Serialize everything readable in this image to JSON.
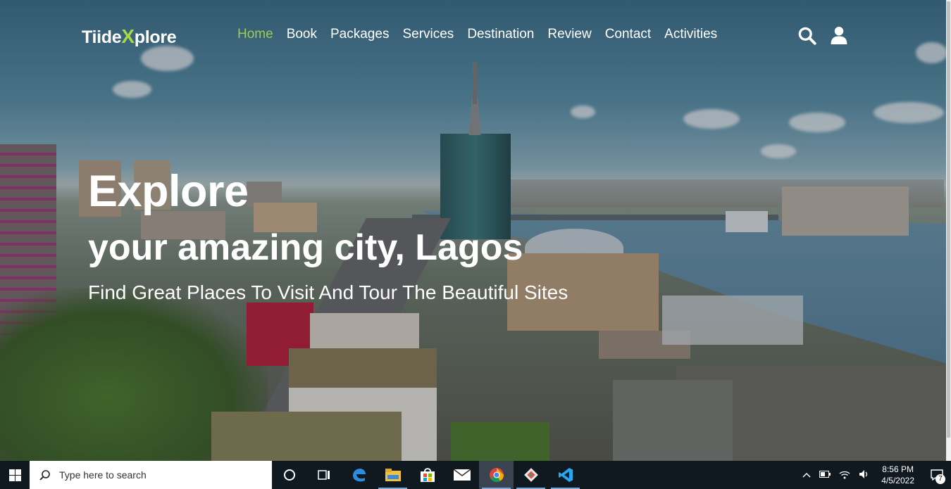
{
  "brand": {
    "prefix": "Tiide",
    "x": "X",
    "suffix": "plore",
    "accent": "#a6d84a"
  },
  "nav": {
    "items": [
      {
        "label": "Home",
        "active": true
      },
      {
        "label": "Book"
      },
      {
        "label": "Packages"
      },
      {
        "label": "Services"
      },
      {
        "label": "Destination"
      },
      {
        "label": "Review"
      },
      {
        "label": "Contact"
      },
      {
        "label": "Activities"
      }
    ],
    "active_color": "#9ccc55",
    "icons": [
      "search-icon",
      "user-icon"
    ]
  },
  "hero": {
    "heading": "Explore",
    "subheading": "your amazing city, Lagos",
    "tagline": "Find Great Places To Visit And Tour The Beautiful Sites"
  },
  "taskbar": {
    "search_placeholder": "Type here to search",
    "apps": [
      "cortana-icon",
      "task-view-icon",
      "edge-icon",
      "file-explorer-icon",
      "store-icon",
      "mail-icon",
      "chrome-icon",
      "git-icon",
      "vscode-icon"
    ],
    "time": "8:56 PM",
    "date": "4/5/2022",
    "notification_count": "7"
  }
}
